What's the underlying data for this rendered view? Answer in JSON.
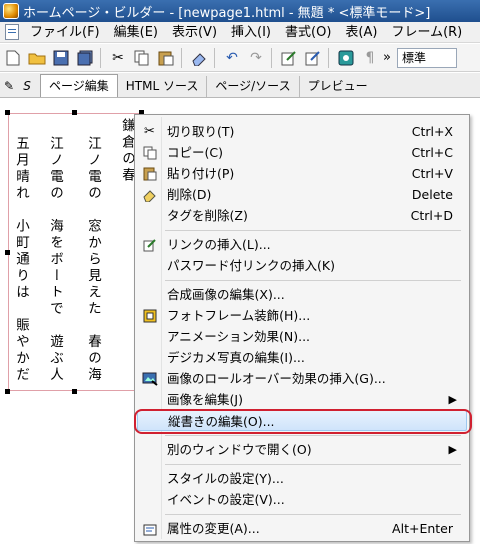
{
  "window": {
    "title": "ホームページ・ビルダー - [newpage1.html - 無題 * <標準モード>]"
  },
  "menubar": [
    "ファイル(F)",
    "編集(E)",
    "表示(V)",
    "挿入(I)",
    "書式(O)",
    "表(A)",
    "フレーム(R)"
  ],
  "toolbar": {
    "more": "»",
    "style_select": "標準"
  },
  "tabs": [
    "ページ編集",
    "HTML ソース",
    "ページ/ソース",
    "プレビュー"
  ],
  "poem": {
    "columns": [
      "鎌倉の春",
      "江ノ電の　窓から見えた　春の海",
      "江ノ電の　海をボートで　遊ぶ人",
      "五月晴れ　小町通りは　賑やかだ"
    ]
  },
  "context_menu": [
    {
      "label": "切り取り(T)",
      "shortcut": "Ctrl+X",
      "icon": "scissors-icon"
    },
    {
      "label": "コピー(C)",
      "shortcut": "Ctrl+C",
      "icon": "copy-icon"
    },
    {
      "label": "貼り付け(P)",
      "shortcut": "Ctrl+V",
      "icon": "paste-icon"
    },
    {
      "label": "削除(D)",
      "shortcut": "Delete",
      "icon": "eraser-icon"
    },
    {
      "label": "タグを削除(Z)",
      "shortcut": "Ctrl+D",
      "icon": ""
    },
    {
      "label": "リンクの挿入(L)...",
      "shortcut": "",
      "icon": "link-edit-icon"
    },
    {
      "label": "パスワード付リンクの挿入(K)",
      "shortcut": "",
      "icon": ""
    },
    {
      "label": "合成画像の編集(X)...",
      "shortcut": "",
      "icon": ""
    },
    {
      "label": "フォトフレーム装飾(H)...",
      "shortcut": "",
      "icon": "photo-frame-icon"
    },
    {
      "label": "アニメーション効果(N)...",
      "shortcut": "",
      "icon": ""
    },
    {
      "label": "デジカメ写真の編集(I)...",
      "shortcut": "",
      "icon": ""
    },
    {
      "label": "画像のロールオーバー効果の挿入(G)...",
      "shortcut": "",
      "icon": "rollover-image-icon"
    },
    {
      "label": "画像を編集(J)",
      "shortcut": "",
      "icon": "",
      "submenu": true
    },
    {
      "label": "縦書きの編集(O)...",
      "shortcut": "",
      "icon": "",
      "highlighted": true
    },
    {
      "label": "別のウィンドウで開く(O)",
      "shortcut": "",
      "icon": "",
      "submenu": true
    },
    {
      "label": "スタイルの設定(Y)...",
      "shortcut": "",
      "icon": ""
    },
    {
      "label": "イベントの設定(V)...",
      "shortcut": "",
      "icon": ""
    },
    {
      "label": "属性の変更(A)...",
      "shortcut": "Alt+Enter",
      "icon": "properties-icon"
    }
  ],
  "colors": {
    "highlight_ring": "#d02030",
    "titlebar": "#2a5c9e"
  }
}
